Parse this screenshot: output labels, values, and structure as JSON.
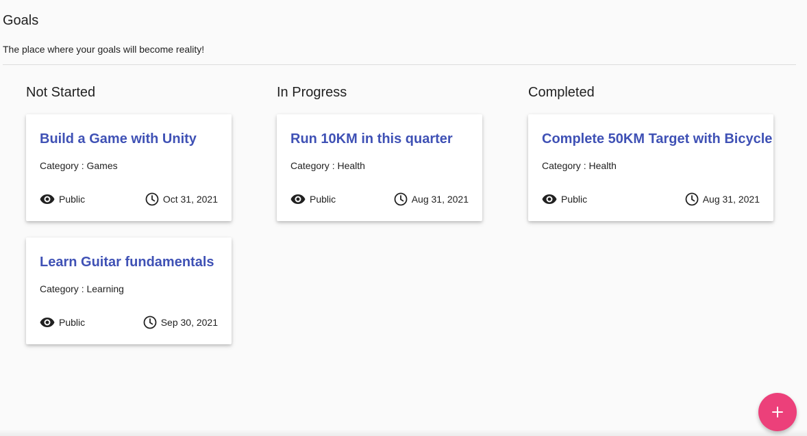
{
  "header": {
    "title": "Goals",
    "subtitle": "The place where your goals will become reality!"
  },
  "columns": [
    {
      "title": "Not Started",
      "cards": [
        {
          "title": "Build a Game with Unity",
          "category": "Category : Games",
          "visibility": "Public",
          "date": "Oct 31, 2021"
        },
        {
          "title": "Learn Guitar fundamentals",
          "category": "Category : Learning",
          "visibility": "Public",
          "date": "Sep 30, 2021"
        }
      ]
    },
    {
      "title": "In Progress",
      "cards": [
        {
          "title": "Run 10KM in this quarter",
          "category": "Category : Health",
          "visibility": "Public",
          "date": "Aug 31, 2021"
        }
      ]
    },
    {
      "title": "Completed",
      "cards": [
        {
          "title": "Complete 50KM Target with Bicycle",
          "category": "Category : Health",
          "visibility": "Public",
          "date": "Aug 31, 2021"
        }
      ]
    }
  ],
  "fab": {
    "icon": "plus-icon"
  },
  "colors": {
    "title_accent": "#3f51b5",
    "fab": "#ec407a"
  }
}
